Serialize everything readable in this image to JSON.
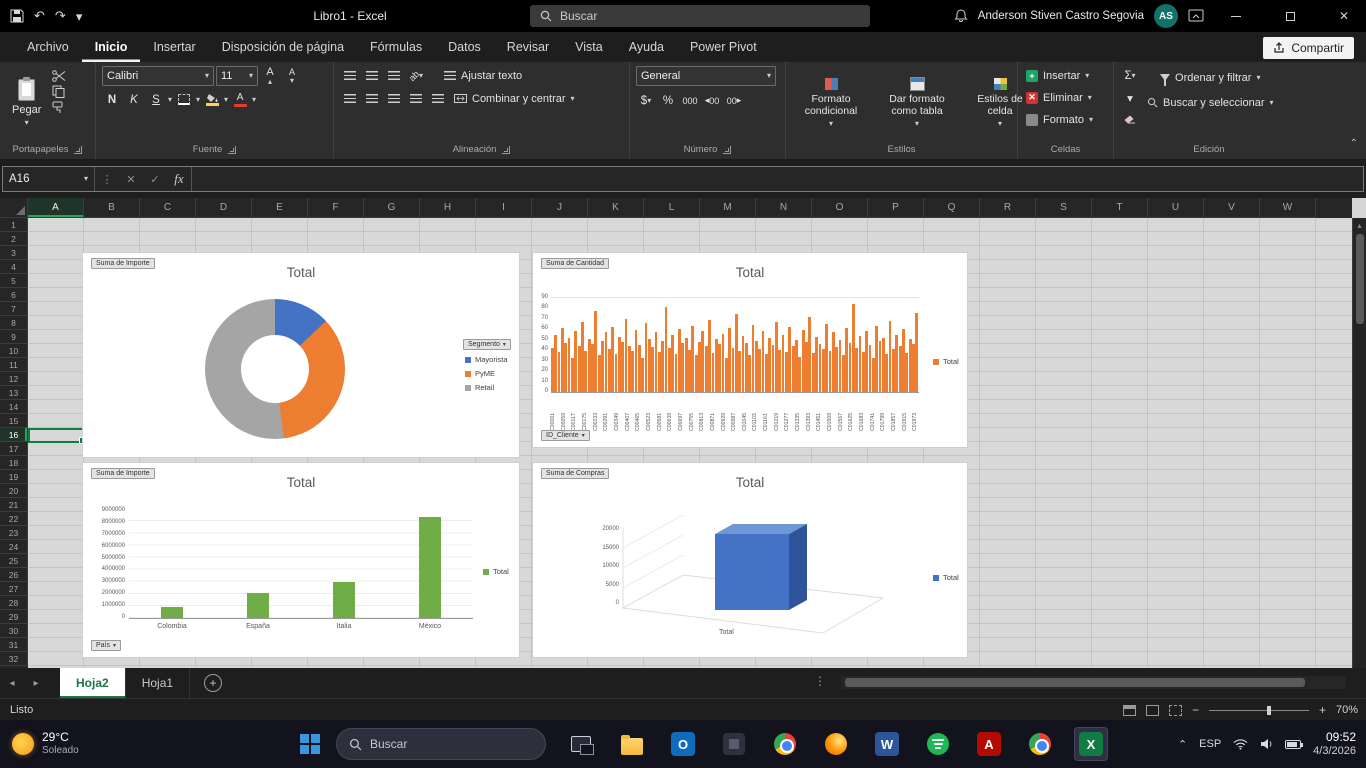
{
  "titlebar": {
    "title": "Libro1 - Excel",
    "search_placeholder": "Buscar",
    "user_name": "Anderson Stiven Castro Segovia",
    "user_initials": "AS"
  },
  "ribbon": {
    "tabs": [
      "Archivo",
      "Inicio",
      "Insertar",
      "Disposición de página",
      "Fórmulas",
      "Datos",
      "Revisar",
      "Vista",
      "Ayuda",
      "Power Pivot"
    ],
    "active_tab": "Inicio",
    "share_label": "Compartir",
    "paste_label": "Pegar",
    "font_name": "Calibri",
    "font_size": "11",
    "bold": "N",
    "italic": "K",
    "underline": "S",
    "wrap_text": "Ajustar texto",
    "merge_center": "Combinar y centrar",
    "number_format": "General",
    "dollar": "$",
    "percent": "%",
    "thousands": "000",
    "zeros": "00",
    "cond_format": "Formato condicional",
    "format_table": "Dar formato como tabla",
    "cell_styles": "Estilos de celda",
    "insert_label": "Insertar",
    "delete_label": "Eliminar",
    "format_label": "Formato",
    "sigma": "Σ",
    "sort_filter": "Ordenar y filtrar",
    "find_select": "Buscar y seleccionar",
    "group_labels": [
      "Portapapeles",
      "Fuente",
      "Alineación",
      "Número",
      "Estilos",
      "Celdas",
      "Edición"
    ]
  },
  "formula_bar": {
    "name_box": "A16",
    "fx": "fx",
    "formula_value": ""
  },
  "sheet": {
    "columns": [
      "A",
      "B",
      "C",
      "D",
      "E",
      "F",
      "G",
      "H",
      "I",
      "J",
      "K",
      "L",
      "M",
      "N",
      "O",
      "P",
      "Q",
      "R",
      "S",
      "T",
      "U",
      "V",
      "W"
    ],
    "rows": [
      1,
      2,
      3,
      4,
      5,
      6,
      7,
      8,
      9,
      10,
      11,
      12,
      13,
      14,
      15,
      16,
      17,
      18,
      19,
      20,
      21,
      22,
      23,
      24,
      25,
      26,
      27,
      28,
      29,
      30,
      31,
      32
    ],
    "selected": {
      "cell": "A16",
      "col": "A",
      "row": 16
    },
    "tabs": [
      {
        "label": "Hoja2",
        "active": true
      },
      {
        "label": "Hoja1",
        "active": false
      }
    ]
  },
  "status_bar": {
    "status": "Listo",
    "zoom": "70%"
  },
  "taskbar": {
    "weather": {
      "temp": "29°C",
      "condition": "Soleado"
    },
    "search_placeholder": "Buscar",
    "icons": [
      "start",
      "task-view",
      "file-explorer",
      "outlook",
      "system-app",
      "chrome",
      "firefox",
      "word",
      "spotify",
      "acrobat",
      "chrome-2",
      "excel"
    ],
    "active_app": "excel",
    "tray": {
      "language": "ESP",
      "time": "09:52",
      "date": "4/3/2026"
    }
  },
  "icons": {
    "undo": "↶",
    "redo": "↷",
    "caret": "▾",
    "caret_up": "⌃",
    "check": "✓",
    "cross": "✕",
    "dots": "⋮",
    "ellipsis": "⋯",
    "plus": "+",
    "left": "◂",
    "right": "▸",
    "up": "▴",
    "down": "▾",
    "word_letter": "W",
    "excel_letter": "X",
    "outlook_letter": "O",
    "acrobat_letter": "A",
    "minus": "−",
    "a_big": "A",
    "a_small": "A",
    "ab": "ab"
  },
  "chart_data": [
    {
      "type": "pie",
      "subtype": "donut",
      "title": "Total",
      "field_button": "Suma de Importe",
      "legend_title": "Segmento",
      "legend_position": "right",
      "categories": [
        "Mayorista",
        "PyME",
        "Retail"
      ],
      "values_pct": [
        13,
        35,
        52
      ],
      "colors": [
        "#4472c4",
        "#ed7d31",
        "#a5a5a5"
      ]
    },
    {
      "type": "bar",
      "title": "Total",
      "field_button": "Suma de Cantidad",
      "axis_button": "ID_Cliente",
      "legend": [
        "Total"
      ],
      "color": "#ed7d31",
      "ylim": [
        0,
        90
      ],
      "yticks": [
        0,
        10,
        20,
        30,
        40,
        50,
        60,
        70,
        80,
        90
      ],
      "x_tick_labels": [
        "C00001",
        "C00059",
        "C00117",
        "C00175",
        "C00233",
        "C00291",
        "C00349",
        "C00407",
        "C00465",
        "C00523",
        "C00581",
        "C00639",
        "C00697",
        "C00755",
        "C00813",
        "C00871",
        "C00929",
        "C00987",
        "C01045",
        "C01103",
        "C01161",
        "C01219",
        "C01277",
        "C01335",
        "C01393",
        "C01451",
        "C01509",
        "C01567",
        "C01625",
        "C01683",
        "C01741",
        "C01799",
        "C01857",
        "C01915",
        "C01973"
      ],
      "values": [
        42,
        55,
        38,
        61,
        47,
        52,
        33,
        58,
        44,
        67,
        39,
        51,
        46,
        78,
        35,
        49,
        57,
        41,
        62,
        36,
        53,
        48,
        70,
        44,
        39,
        59,
        45,
        33,
        66,
        51,
        43,
        57,
        38,
        49,
        81,
        42,
        55,
        36,
        60,
        47,
        52,
        40,
        63,
        35,
        48,
        58,
        44,
        69,
        37,
        51,
        46,
        56,
        33,
        61,
        42,
        75,
        39,
        54,
        47,
        35,
        64,
        49,
        41,
        58,
        36,
        52,
        45,
        67,
        40,
        55,
        38,
        62,
        44,
        50,
        34,
        59,
        48,
        72,
        37,
        53,
        46,
        41,
        65,
        39,
        57,
        43,
        50,
        35,
        61,
        47,
        84,
        42,
        54,
        38,
        58,
        45,
        33,
        63,
        49,
        52,
        36,
        68,
        41,
        55,
        44,
        60,
        37,
        51,
        46,
        76
      ]
    },
    {
      "type": "bar",
      "title": "Total",
      "field_button": "Suma de Importe",
      "axis_button": "País",
      "legend": [
        "Total"
      ],
      "color": "#70ad47",
      "ylim": [
        0,
        9000000
      ],
      "yticks": [
        0,
        1000000,
        2000000,
        3000000,
        4000000,
        5000000,
        6000000,
        7000000,
        8000000,
        9000000
      ],
      "categories": [
        "Colombia",
        "España",
        "Italia",
        "México"
      ],
      "values": [
        900000,
        2100000,
        3000000,
        8400000
      ]
    },
    {
      "type": "bar",
      "subtype": "3d-column",
      "title": "Total",
      "field_button": "Suma de Compras",
      "legend": [
        "Total"
      ],
      "color": "#4472c4",
      "ylim": [
        0,
        20000
      ],
      "yticks": [
        0,
        5000,
        10000,
        15000,
        20000
      ],
      "categories": [
        "Total"
      ],
      "values": [
        19500
      ]
    }
  ]
}
